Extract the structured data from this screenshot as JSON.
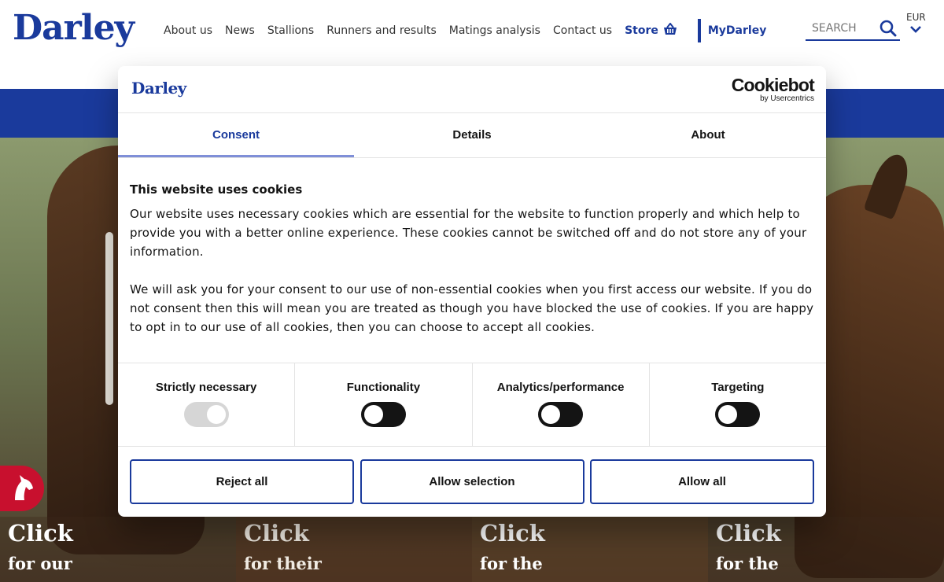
{
  "site": {
    "logo": "Darley",
    "nav": [
      "About us",
      "News",
      "Stallions",
      "Runners and results",
      "Matings analysis",
      "Contact us"
    ],
    "store_label": "Store",
    "mydarley_label": "MyDarley",
    "search_placeholder": "SEARCH",
    "currency": "EUR"
  },
  "tiles": [
    {
      "title": "Click",
      "subtitle": "for our"
    },
    {
      "title": "Click",
      "subtitle": "for their"
    },
    {
      "title": "Click",
      "subtitle": "for the"
    },
    {
      "title": "Click",
      "subtitle": "for the"
    }
  ],
  "dialog": {
    "logo": "Darley",
    "cookiebot_title": "Cookiebot",
    "cookiebot_sub": "by Usercentrics",
    "tabs": [
      "Consent",
      "Details",
      "About"
    ],
    "heading": "This website uses cookies",
    "para1": "Our website uses necessary cookies which are essential for the website to function properly and which help to provide you with a better online experience. These cookies cannot be switched off and do not store any of your information.",
    "para2": "We will ask you for your consent to our use of non-essential cookies when you first access our website.  If you do not consent then this will mean you are treated as though you have blocked the use of cookies. If you are happy to opt in to our use of all cookies, then you can choose to accept all cookies.",
    "prefs": [
      "Strictly necessary",
      "Functionality",
      "Analytics/performance",
      "Targeting"
    ],
    "buttons": {
      "reject": "Reject all",
      "selection": "Allow selection",
      "allow": "Allow all"
    }
  },
  "colors": {
    "brand": "#1a3a9c",
    "badge": "#c8102e",
    "toggle_on": "#141414",
    "toggle_disabled": "#d6d6d6"
  },
  "icons": [
    "search-icon",
    "basket-icon",
    "chevron-down-icon",
    "horse-head-icon"
  ]
}
